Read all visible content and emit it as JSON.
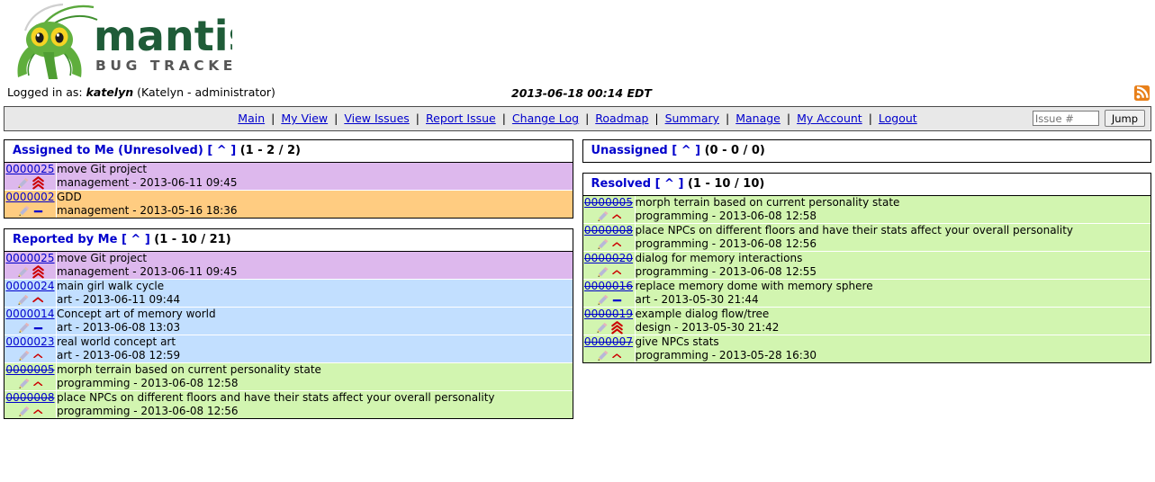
{
  "app": {
    "logo_text_main": "mantis",
    "logo_text_sub": "BUG TRACKER"
  },
  "header": {
    "logged_in_prefix": "Logged in as:",
    "username": "katelyn",
    "user_detail": "(Katelyn - administrator)",
    "timestamp": "2013-06-18 00:14 EDT",
    "rss_icon": "rss-icon"
  },
  "nav": {
    "items": [
      {
        "label": "Main"
      },
      {
        "label": "My View"
      },
      {
        "label": "View Issues"
      },
      {
        "label": "Report Issue"
      },
      {
        "label": "Change Log"
      },
      {
        "label": "Roadmap"
      },
      {
        "label": "Summary"
      },
      {
        "label": "Manage"
      },
      {
        "label": "My Account"
      },
      {
        "label": "Logout"
      }
    ],
    "separator": "|",
    "issue_placeholder": "Issue #",
    "issue_value": "",
    "jump_label": "Jump"
  },
  "panels": {
    "assigned": {
      "title": "Assigned to Me (Unresolved)",
      "caret": "[ ^ ]",
      "count": "(1 - 2 / 2)",
      "rows": [
        {
          "id": "0000025",
          "resolved": false,
          "color": "c-pink",
          "priority": "urgent",
          "summary": "move Git project",
          "meta": "management - 2013-06-11 09:45"
        },
        {
          "id": "0000002",
          "resolved": false,
          "color": "c-orange",
          "priority": "none",
          "summary": "GDD",
          "meta": "management - 2013-05-16 18:36"
        }
      ]
    },
    "unassigned": {
      "title": "Unassigned",
      "caret": "[ ^ ]",
      "count": "(0 - 0 / 0)",
      "rows": []
    },
    "reported": {
      "title": "Reported by Me",
      "caret": "[ ^ ]",
      "count": "(1 - 10 / 21)",
      "rows": [
        {
          "id": "0000025",
          "resolved": false,
          "color": "c-pink",
          "priority": "urgent",
          "summary": "move Git project",
          "meta": "management - 2013-06-11 09:45"
        },
        {
          "id": "0000024",
          "resolved": false,
          "color": "c-blue",
          "priority": "high",
          "summary": "main girl walk cycle",
          "meta": "art - 2013-06-11 09:44"
        },
        {
          "id": "0000014",
          "resolved": false,
          "color": "c-blue",
          "priority": "none",
          "summary": "Concept art of memory world",
          "meta": "art - 2013-06-08 13:03"
        },
        {
          "id": "0000023",
          "resolved": false,
          "color": "c-blue",
          "priority": "normal",
          "summary": "real world concept art",
          "meta": "art - 2013-06-08 12:59"
        },
        {
          "id": "0000005",
          "resolved": true,
          "color": "c-green",
          "priority": "normal",
          "summary": "morph terrain based on current personality state",
          "meta": "programming - 2013-06-08 12:58"
        },
        {
          "id": "0000008",
          "resolved": true,
          "color": "c-green",
          "priority": "normal",
          "summary": "place NPCs on different floors and have their stats affect your overall personality",
          "meta": "programming - 2013-06-08 12:56"
        }
      ]
    },
    "resolved": {
      "title": "Resolved",
      "caret": "[ ^ ]",
      "count": "(1 - 10 / 10)",
      "rows": [
        {
          "id": "0000005",
          "resolved": true,
          "color": "c-green",
          "priority": "normal",
          "summary": "morph terrain based on current personality state",
          "meta": "programming - 2013-06-08 12:58"
        },
        {
          "id": "0000008",
          "resolved": true,
          "color": "c-green",
          "priority": "normal",
          "summary": "place NPCs on different floors and have their stats affect your overall personality",
          "meta": "programming - 2013-06-08 12:56"
        },
        {
          "id": "0000020",
          "resolved": true,
          "color": "c-green",
          "priority": "normal",
          "summary": "dialog for memory interactions",
          "meta": "programming - 2013-06-08 12:55"
        },
        {
          "id": "0000016",
          "resolved": true,
          "color": "c-green",
          "priority": "none",
          "summary": "replace memory dome with memory sphere",
          "meta": "art - 2013-05-30 21:44"
        },
        {
          "id": "0000019",
          "resolved": true,
          "color": "c-green",
          "priority": "urgent",
          "summary": "example dialog flow/tree",
          "meta": "design - 2013-05-30 21:42"
        },
        {
          "id": "0000007",
          "resolved": true,
          "color": "c-green",
          "priority": "normal",
          "summary": "give NPCs stats",
          "meta": "programming - 2013-05-28 16:30"
        }
      ]
    }
  },
  "colors": {
    "link": "#0000cc",
    "nav_bg": "#e8e8e8",
    "row_pink": "#ddb8ed",
    "row_orange": "#ffcc81",
    "row_blue": "#c2dfff",
    "row_green": "#d2f5b0",
    "priority_red": "#cc0000",
    "priority_blue": "#0000cc",
    "rss_orange": "#e8801a"
  }
}
